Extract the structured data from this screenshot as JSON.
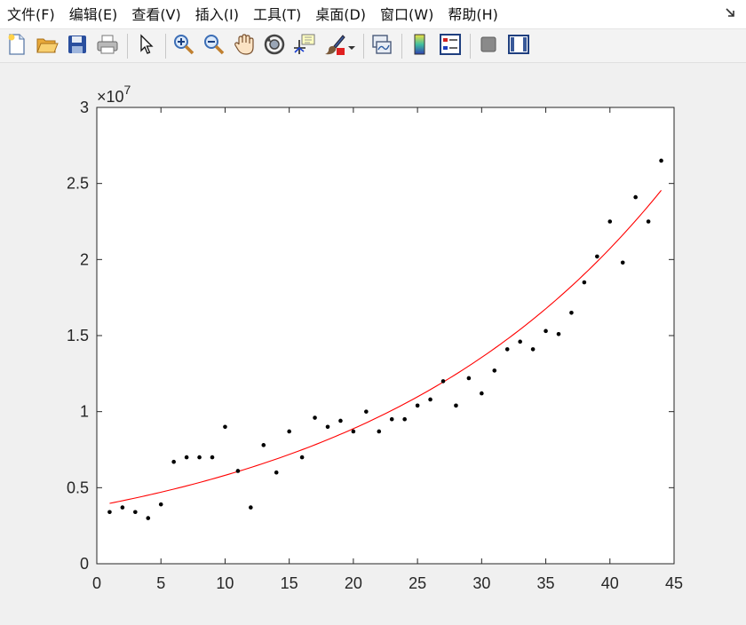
{
  "menubar": {
    "items": [
      "文件(F)",
      "编辑(E)",
      "查看(V)",
      "插入(I)",
      "工具(T)",
      "桌面(D)",
      "窗口(W)",
      "帮助(H)"
    ]
  },
  "toolbar": {
    "buttons": [
      "new-file-icon",
      "open-folder-icon",
      "save-icon",
      "print-icon",
      "pointer-icon",
      "zoom-in-icon",
      "zoom-out-icon",
      "pan-hand-icon",
      "rotate-3d-icon",
      "data-cursor-icon",
      "brush-icon",
      "link-plot-icon",
      "colorbar-icon",
      "legend-icon",
      "hide-plot-tools-icon",
      "show-plot-tools-icon"
    ]
  },
  "chart_data": {
    "type": "scatter",
    "title": "",
    "xlabel": "",
    "ylabel": "",
    "xlim": [
      0,
      45
    ],
    "ylim": [
      0,
      3
    ],
    "y_exponent_label": "×10",
    "y_exponent_power": "7",
    "xticks": [
      "0",
      "5",
      "10",
      "15",
      "20",
      "25",
      "30",
      "35",
      "40",
      "45"
    ],
    "yticks": [
      "0",
      "0.5",
      "1",
      "1.5",
      "2",
      "2.5",
      "3"
    ],
    "grid": false,
    "series": [
      {
        "kind": "points",
        "color": "#000000",
        "x": [
          1,
          2,
          3,
          4,
          5,
          6,
          7,
          8,
          9,
          10,
          11,
          12,
          13,
          14,
          15,
          16,
          17,
          18,
          19,
          20,
          21,
          22,
          23,
          24,
          25,
          26,
          27,
          28,
          29,
          30,
          31,
          32,
          33,
          34,
          35,
          36,
          37,
          38,
          39,
          40,
          41,
          42,
          43,
          44
        ],
        "y": [
          0.34,
          0.37,
          0.34,
          0.3,
          0.39,
          0.67,
          0.7,
          0.7,
          0.7,
          0.9,
          0.61,
          0.37,
          0.78,
          0.6,
          0.87,
          0.7,
          0.96,
          0.9,
          0.94,
          0.87,
          1.0,
          0.87,
          0.95,
          0.95,
          1.04,
          1.08,
          1.2,
          1.04,
          1.22,
          1.12,
          1.27,
          1.41,
          1.46,
          1.41,
          1.53,
          1.51,
          1.65,
          1.85,
          2.02,
          2.25,
          1.98,
          2.41,
          2.25,
          2.65
        ]
      },
      {
        "kind": "fit-curve",
        "color": "#ff0000",
        "x_start": 1,
        "x_end": 44,
        "y_start": 0.397,
        "growth_rate": 0.04237
      }
    ]
  }
}
